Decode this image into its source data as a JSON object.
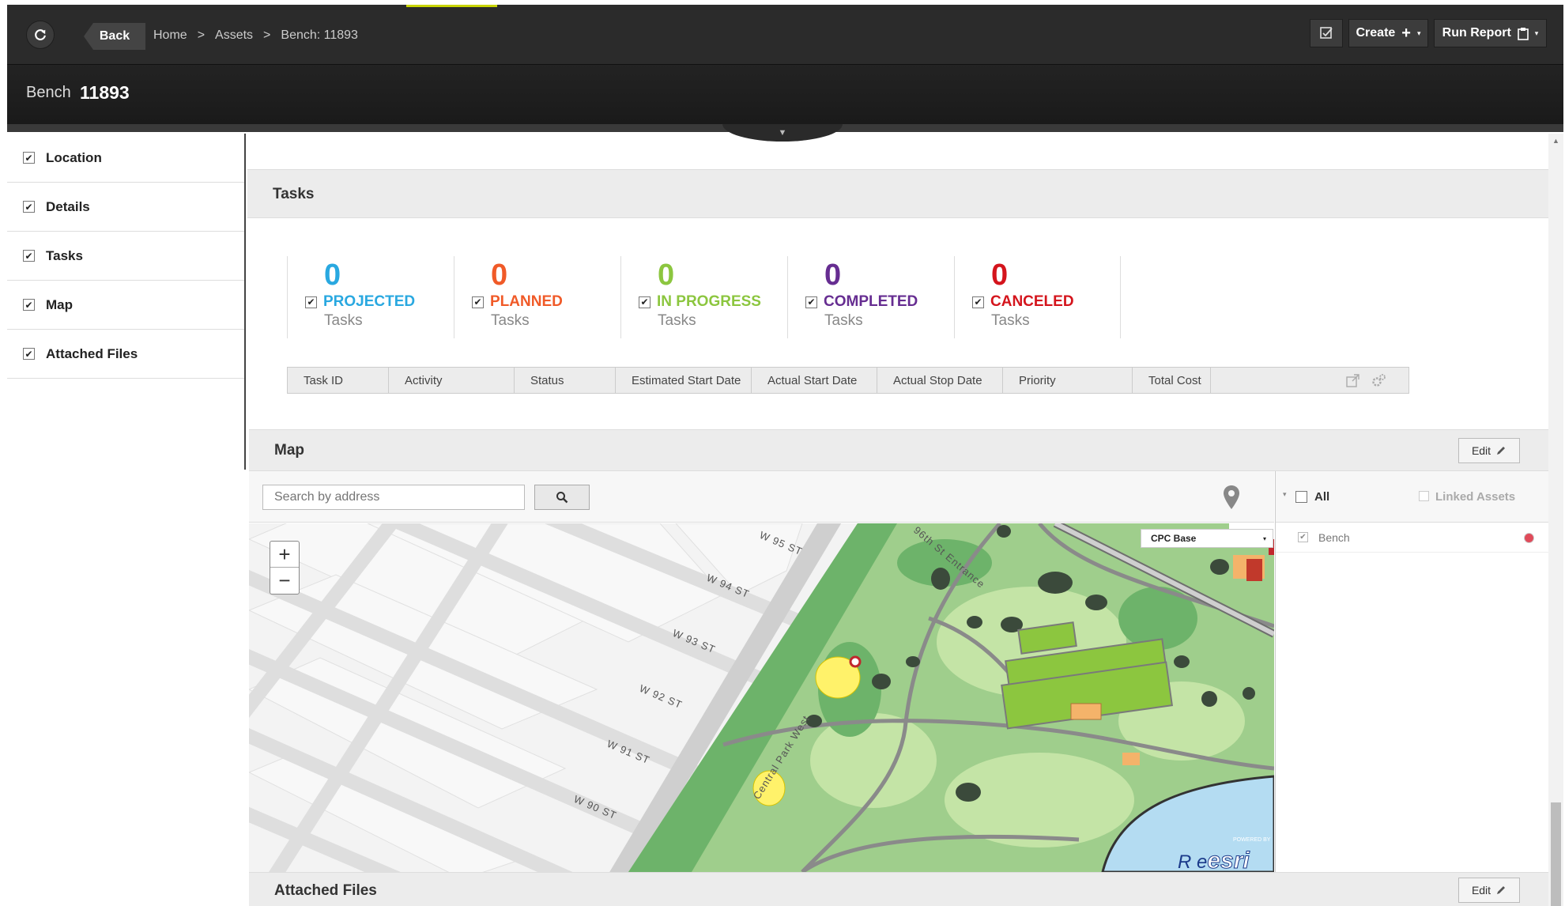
{
  "header": {
    "back_label": "Back",
    "breadcrumb": [
      "Home",
      "Assets",
      "Bench: 11893"
    ],
    "breadcrumb_sep": ">",
    "create_label": "Create",
    "run_report_label": "Run Report"
  },
  "title": {
    "type": "Bench",
    "id": "11893"
  },
  "sidebar": {
    "items": [
      {
        "label": "Location",
        "checked": true
      },
      {
        "label": "Details",
        "checked": true
      },
      {
        "label": "Tasks",
        "checked": true
      },
      {
        "label": "Map",
        "checked": true
      },
      {
        "label": "Attached Files",
        "checked": true
      }
    ]
  },
  "tasks": {
    "title": "Tasks",
    "stats": [
      {
        "count": "0",
        "label": "PROJECTED",
        "sub": "Tasks",
        "color": "#29a8e0"
      },
      {
        "count": "0",
        "label": "PLANNED",
        "sub": "Tasks",
        "color": "#f05a28"
      },
      {
        "count": "0",
        "label": "IN PROGRESS",
        "sub": "Tasks",
        "color": "#8cc63f"
      },
      {
        "count": "0",
        "label": "COMPLETED",
        "sub": "Tasks",
        "color": "#662d91"
      },
      {
        "count": "0",
        "label": "CANCELED",
        "sub": "Tasks",
        "color": "#d4141c"
      }
    ],
    "columns": [
      "Task ID",
      "Activity",
      "Status",
      "Estimated Start Date",
      "Actual Start Date",
      "Actual Stop Date",
      "Priority",
      "Total Cost"
    ]
  },
  "map": {
    "title": "Map",
    "edit_label": "Edit",
    "search_placeholder": "Search by address",
    "basemap": "CPC Base",
    "layers_all_label": "All",
    "linked_assets_label": "Linked Assets",
    "layer_item": "Bench",
    "attribution": "R e",
    "esri_logo": "esri",
    "powered_by": "POWERED BY",
    "street_labels": [
      "W 95 ST",
      "W 94 ST",
      "W 93 ST",
      "W 92 ST",
      "W 91 ST",
      "W 90 ST",
      "96th St Entrance",
      "Central Park West"
    ]
  },
  "attached_files": {
    "title": "Attached Files",
    "edit_label": "Edit"
  }
}
